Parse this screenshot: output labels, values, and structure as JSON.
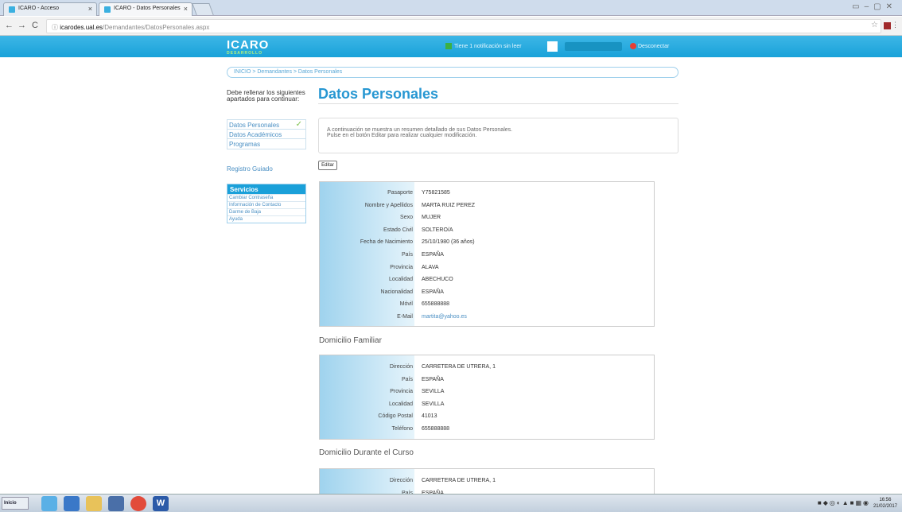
{
  "browser": {
    "tabs": [
      {
        "label": "ICARO - Acceso"
      },
      {
        "label": "ICARO - Datos Personales"
      }
    ],
    "url_domain": "icarodes.ual.es",
    "url_path": "/Demandantes/DatosPersonales.aspx"
  },
  "header": {
    "logo": "ICARO",
    "logo_sub": "DESARROLLO",
    "notification": "Tiene 1 notificación sin leer",
    "disconnect": "Desconectar"
  },
  "breadcrumb": "INICIO > Demandantes > Datos Personales",
  "sidebar": {
    "intro": "Debe rellenar los siguientes apartados para continuar:",
    "steps": [
      {
        "label": "Datos Personales",
        "done": true
      },
      {
        "label": "Datos Académicos",
        "done": false
      },
      {
        "label": "Programas",
        "done": false
      }
    ],
    "registro": "Registro Guiado",
    "services_title": "Servicios",
    "services": [
      {
        "label": "Cambiar Contraseña"
      },
      {
        "label": "Información de Contacto"
      },
      {
        "label": "Darme de Baja"
      },
      {
        "label": "Ayuda"
      }
    ]
  },
  "main": {
    "title": "Datos Personales",
    "intro_line1": "A continuación se muestra un resumen detallado de sus Datos Personales.",
    "intro_line2": "Pulse en el botón Editar para realizar cualquier modificación.",
    "edit_label": "Editar",
    "personal": [
      {
        "label": "Pasaporte",
        "value": "Y75821585"
      },
      {
        "label": "Nombre y Apellidos",
        "value": "MARTA RUIZ PEREZ"
      },
      {
        "label": "Sexo",
        "value": "MUJER"
      },
      {
        "label": "Estado Civil",
        "value": "SOLTERO/A"
      },
      {
        "label": "Fecha de Nacimiento",
        "value": "25/10/1980 (36 años)"
      },
      {
        "label": "País",
        "value": "ESPAÑA"
      },
      {
        "label": "Provincia",
        "value": "ALAVA"
      },
      {
        "label": "Localidad",
        "value": "ABECHUCO"
      },
      {
        "label": "Nacionalidad",
        "value": "ESPAÑA"
      },
      {
        "label": "Móvil",
        "value": "655888888"
      },
      {
        "label": "E-Mail",
        "value": "martita@yahoo.es",
        "link": true
      }
    ],
    "familiar_title": "Domicilio Familiar",
    "familiar": [
      {
        "label": "Dirección",
        "value": "CARRETERA DE UTRERA, 1"
      },
      {
        "label": "País",
        "value": "ESPAÑA"
      },
      {
        "label": "Provincia",
        "value": "SEVILLA"
      },
      {
        "label": "Localidad",
        "value": "SEVILLA"
      },
      {
        "label": "Código Postal",
        "value": "41013"
      },
      {
        "label": "Teléfono",
        "value": "655888888"
      }
    ],
    "curso_title": "Domicilio Durante el Curso",
    "curso": [
      {
        "label": "Dirección",
        "value": "CARRETERA DE UTRERA, 1"
      },
      {
        "label": "País",
        "value": "ESPAÑA"
      }
    ]
  },
  "taskbar": {
    "start": "Inicio",
    "clock_time": "16:56",
    "clock_date": "21/02/2017"
  }
}
